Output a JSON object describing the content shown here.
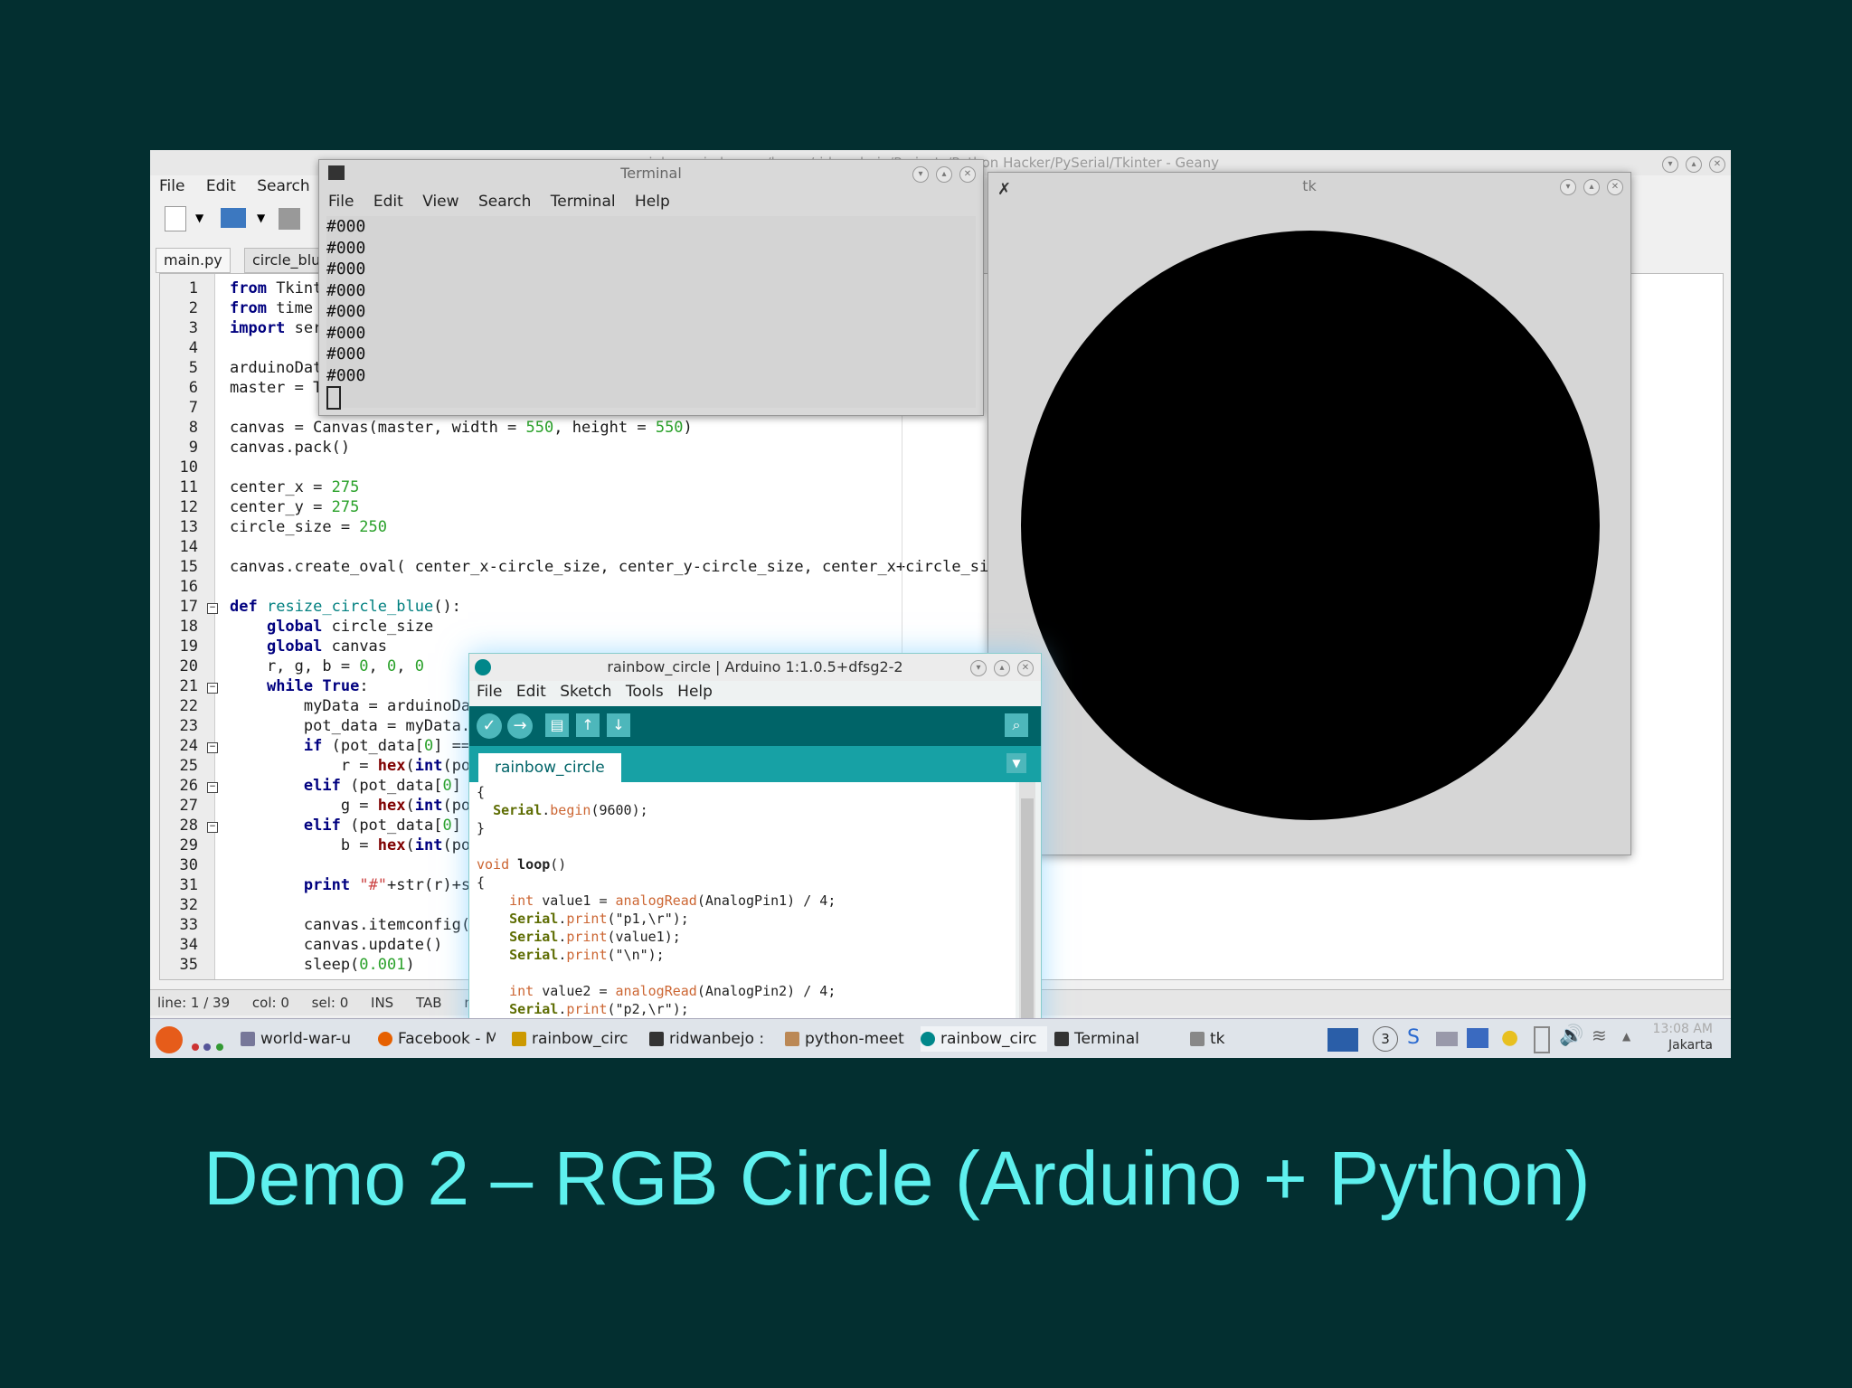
{
  "slide": {
    "title": "Demo 2 – RGB Circle (Arduino + Python)"
  },
  "geany": {
    "title": "rainbow_circle.py - /home/ridwanbejo/Projects/Python Hacker/PySerial/Tkinter - Geany",
    "menu": [
      "File",
      "Edit",
      "Search"
    ],
    "tabs": [
      "main.py",
      "circle_blu"
    ],
    "lines": [
      "1",
      "2",
      "3",
      "4",
      "5",
      "6",
      "7",
      "8",
      "9",
      "10",
      "11",
      "12",
      "13",
      "14",
      "15",
      "16",
      "17",
      "18",
      "19",
      "20",
      "21",
      "22",
      "23",
      "24",
      "25",
      "26",
      "27",
      "28",
      "29",
      "30",
      "31",
      "32",
      "33",
      "34",
      "35"
    ],
    "status": {
      "line": "line: 1 / 39",
      "col": "col: 0",
      "sel": "sel: 0",
      "ins": "INS",
      "tab": "TAB",
      "mode": "mo"
    }
  },
  "terminal": {
    "title": "Terminal",
    "menu": [
      "File",
      "Edit",
      "View",
      "Search",
      "Terminal",
      "Help"
    ],
    "output": [
      "#000",
      "#000",
      "#000",
      "#000",
      "#000",
      "#000",
      "#000",
      "#000"
    ]
  },
  "tk": {
    "title": "tk"
  },
  "arduino": {
    "title": "rainbow_circle | Arduino 1:1.0.5+dfsg2-2",
    "menu": [
      "File",
      "Edit",
      "Sketch",
      "Tools",
      "Help"
    ],
    "tab": "rainbow_circle"
  },
  "taskbar": {
    "items": [
      "world-war-u",
      "Facebook - M",
      "rainbow_circ",
      "ridwanbejo : ",
      "python-meet",
      "rainbow_circ",
      "Terminal",
      "tk"
    ],
    "tray_badge": "3",
    "clock_time": "13:08 AM",
    "clock_zone": "Jakarta"
  }
}
